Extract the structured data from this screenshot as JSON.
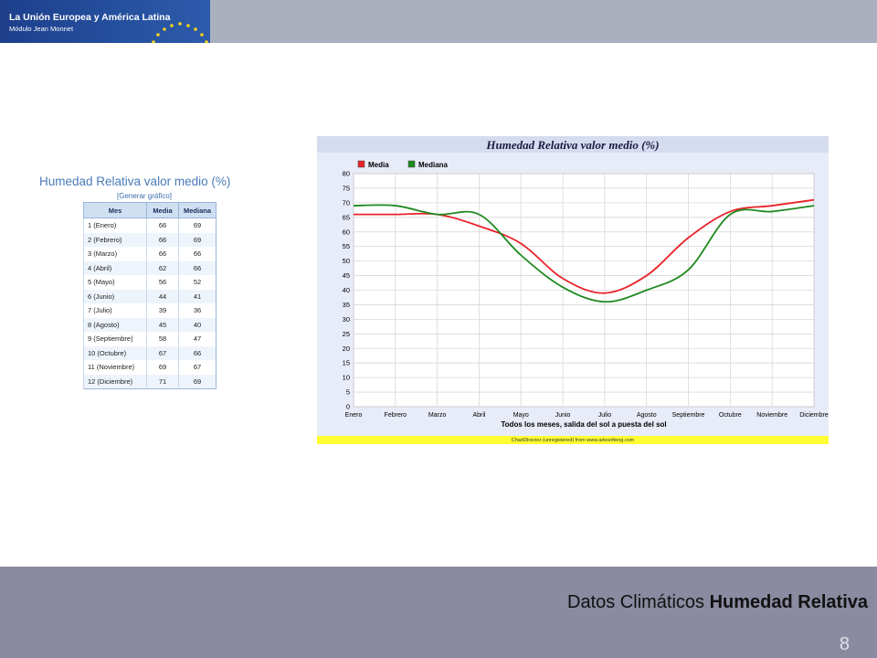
{
  "header": {
    "logo_title": "La Unión Europea y América Latina",
    "logo_subtitle": "Módulo Jean Monnet"
  },
  "table": {
    "title": "Humedad Relativa valor medio (%)",
    "link": "[Generar gráfico]",
    "columns": [
      "Mes",
      "Media",
      "Mediana"
    ],
    "rows": [
      [
        "1 (Enero)",
        "66",
        "69"
      ],
      [
        "2 (Febrero)",
        "66",
        "69"
      ],
      [
        "3 (Marzo)",
        "66",
        "66"
      ],
      [
        "4 (Abril)",
        "62",
        "66"
      ],
      [
        "5 (Mayo)",
        "56",
        "52"
      ],
      [
        "6 (Junio)",
        "44",
        "41"
      ],
      [
        "7 (Julio)",
        "39",
        "36"
      ],
      [
        "8 (Agosto)",
        "45",
        "40"
      ],
      [
        "9 (Septiembre)",
        "58",
        "47"
      ],
      [
        "10 (Octubre)",
        "67",
        "66"
      ],
      [
        "11 (Noviembre)",
        "69",
        "67"
      ],
      [
        "12 (Diciembre)",
        "71",
        "69"
      ]
    ]
  },
  "chart_data": {
    "type": "line",
    "title": "Humedad Relativa valor medio (%)",
    "xlabel": "Todos los meses, salida del sol a puesta del sol",
    "ylabel": "",
    "footnote": "ChartDirector (unregistered) from www.advsofteng.com",
    "categories": [
      "Enero",
      "Febrero",
      "Marzo",
      "Abril",
      "Mayo",
      "Junio",
      "Julio",
      "Agosto",
      "Septiembre",
      "Octubre",
      "Noviembre",
      "Diciembre"
    ],
    "ylim": [
      0,
      80
    ],
    "yticks": [
      0,
      5,
      10,
      15,
      20,
      25,
      30,
      35,
      40,
      45,
      50,
      55,
      60,
      65,
      70,
      75,
      80
    ],
    "grid": true,
    "legend_position": "top-left",
    "series": [
      {
        "name": "Media",
        "color": "#e8232a",
        "values": [
          66,
          66,
          66,
          62,
          56,
          44,
          39,
          45,
          58,
          67,
          69,
          71
        ]
      },
      {
        "name": "Mediana",
        "color": "#1f8a1f",
        "values": [
          69,
          69,
          66,
          66,
          52,
          41,
          36,
          40,
          47,
          66,
          67,
          69
        ]
      }
    ]
  },
  "footer": {
    "title_regular": "Datos Climáticos ",
    "title_bold": "Humedad Relativa",
    "page_number": "8"
  }
}
